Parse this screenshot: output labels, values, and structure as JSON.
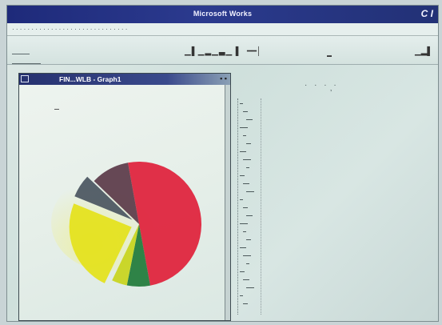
{
  "window": {
    "title": "Microsoft Works",
    "corner_controls": "C I"
  },
  "menu": {
    "items": []
  },
  "graph_window": {
    "title": "FIN...WLB - Graph1"
  },
  "colors": {
    "titlebar": "#1e2a7a",
    "slice_red": "#e0203a",
    "slice_yellow": "#e4e21a",
    "slice_green": "#1f7a3a",
    "slice_dark": "#4a5560"
  },
  "chart_data": {
    "type": "pie",
    "slices": [
      {
        "value": 50,
        "color": "#e0203a"
      },
      {
        "value": 6,
        "color": "#1f7a3a"
      },
      {
        "value": 4,
        "color": "#c8d41c"
      },
      {
        "value": 24,
        "color": "#e4e21a"
      },
      {
        "value": 6,
        "color": "#4a5560"
      },
      {
        "value": 10,
        "color": "#5b3a48"
      }
    ],
    "exploded": [
      false,
      false,
      false,
      true,
      true,
      false
    ]
  }
}
